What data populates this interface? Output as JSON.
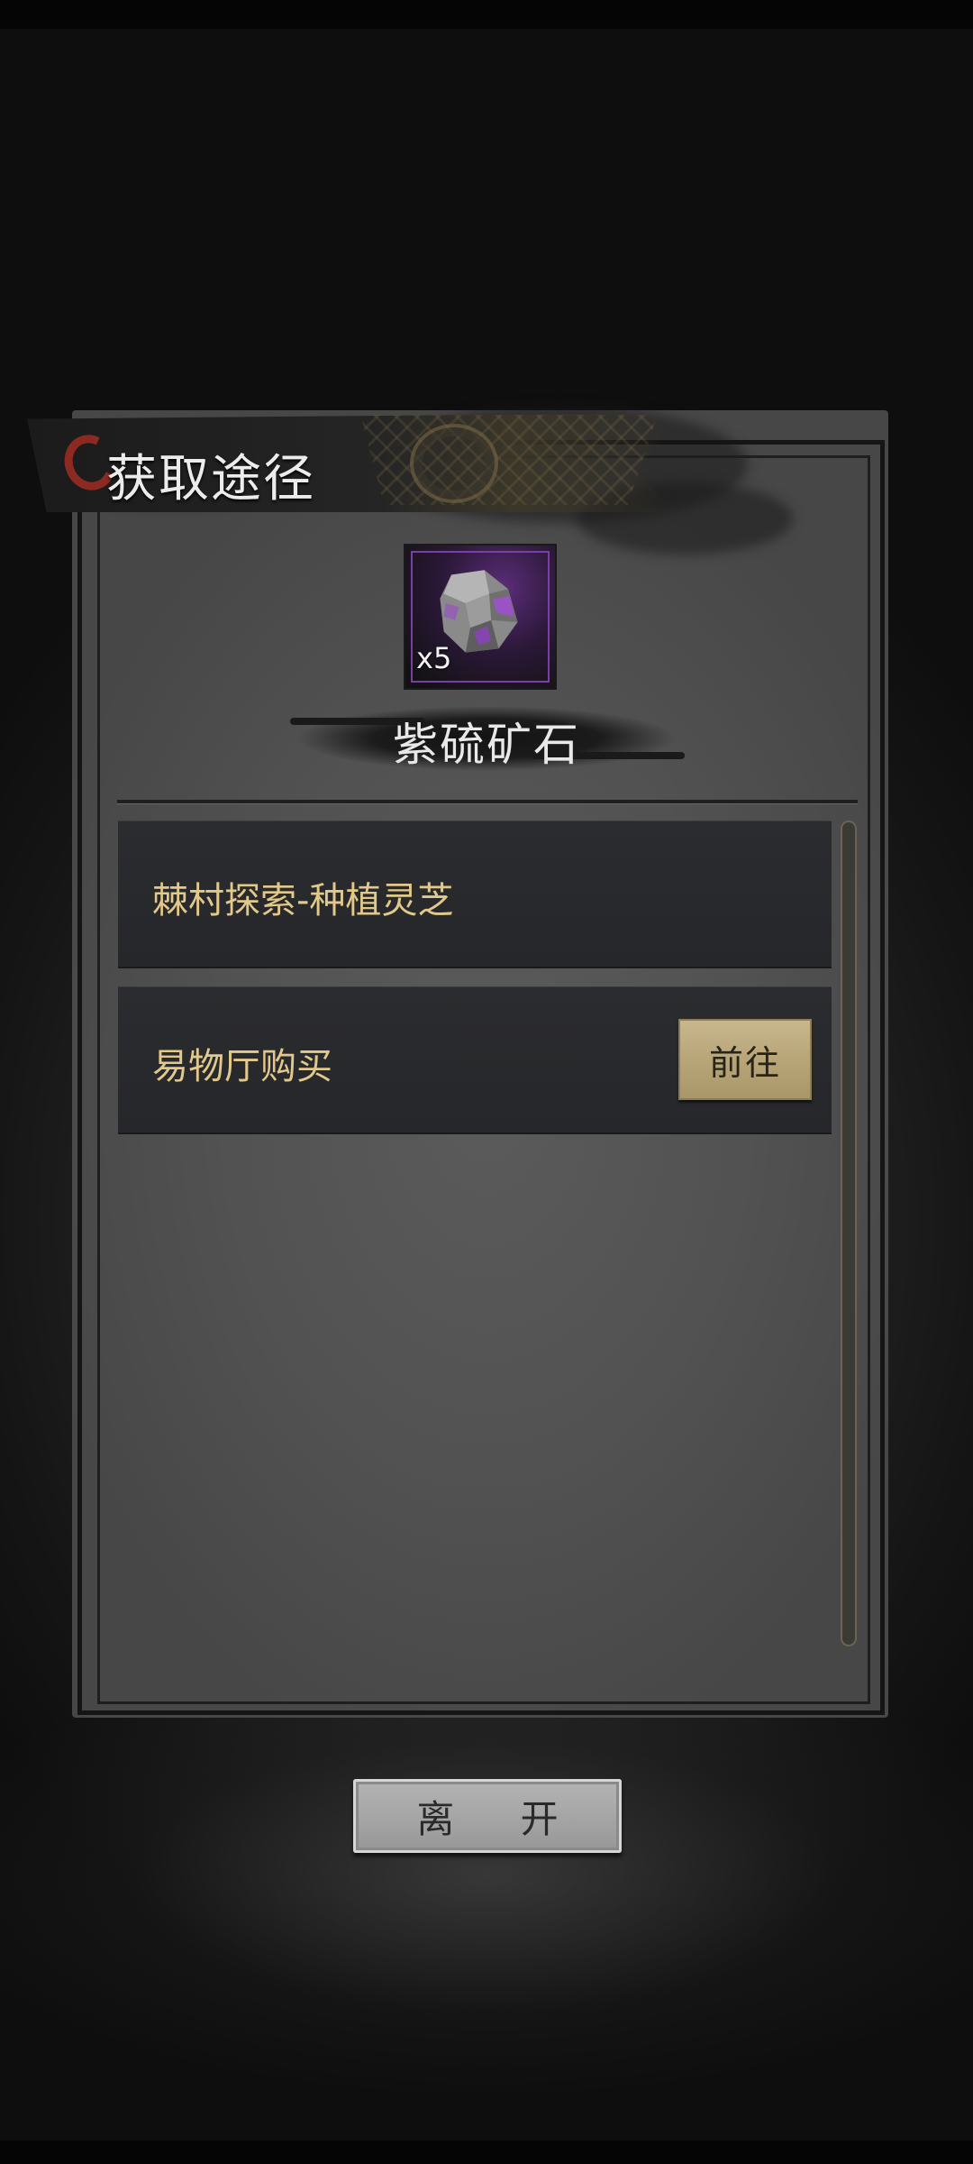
{
  "header": {
    "title": "获取途径"
  },
  "item": {
    "quantity": "x5",
    "name": "紫硫矿石",
    "icon": "purple-ore-icon"
  },
  "sources": [
    {
      "label": "棘村探索-种植灵芝",
      "has_button": false
    },
    {
      "label": "易物厅购买",
      "has_button": true,
      "button_label": "前往"
    }
  ],
  "footer": {
    "leave_label": "离 开"
  },
  "colors": {
    "gold_text": "#e2c98b",
    "go_button": "#b8a679",
    "item_border": "#7a3fa6"
  }
}
